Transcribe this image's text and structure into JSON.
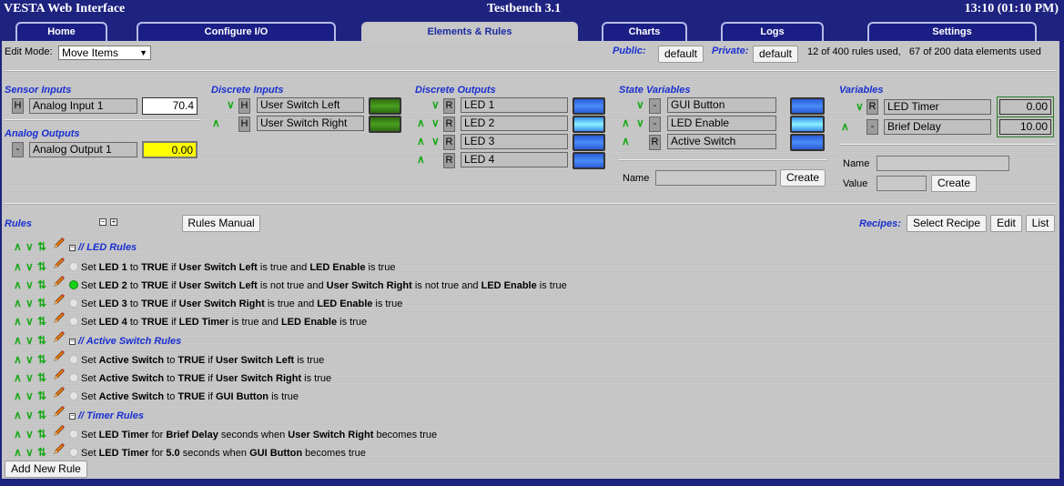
{
  "header": {
    "app_title": "VESTA Web Interface",
    "device": "Testbench 3.1",
    "clock": "13:10 (01:10 PM)"
  },
  "tabs": [
    {
      "label": "Home"
    },
    {
      "label": "Configure I/O"
    },
    {
      "label": "Elements & Rules"
    },
    {
      "label": "Charts"
    },
    {
      "label": "Logs"
    },
    {
      "label": "Settings"
    }
  ],
  "toolbar": {
    "edit_mode_label": "Edit Mode:",
    "edit_mode_value": "Move Items",
    "public_label": "Public:",
    "public_value": "default",
    "private_label": "Private:",
    "private_value": "default",
    "usage": "12 of 400 rules used,   67 of 200 data elements used"
  },
  "sensor_inputs": {
    "title": "Sensor Inputs",
    "items": [
      {
        "tag": "H",
        "name": "Analog Input  1",
        "value": "70.4"
      }
    ]
  },
  "analog_outputs": {
    "title": "Analog Outputs",
    "items": [
      {
        "tag": "-",
        "name": "Analog Output  1",
        "value": "0.00"
      }
    ]
  },
  "discrete_inputs": {
    "title": "Discrete Inputs",
    "items": [
      {
        "tag": "H",
        "name": "User Switch Left"
      },
      {
        "tag": "H",
        "name": "User Switch Right"
      }
    ]
  },
  "discrete_outputs": {
    "title": "Discrete Outputs",
    "items": [
      {
        "tag": "R",
        "name": "LED 1"
      },
      {
        "tag": "R",
        "name": "LED 2"
      },
      {
        "tag": "R",
        "name": "LED 3"
      },
      {
        "tag": "R",
        "name": "LED 4"
      }
    ]
  },
  "state_variables": {
    "title": "State Variables",
    "items": [
      {
        "tag": "-",
        "name": "GUI Button"
      },
      {
        "tag": "-",
        "name": "LED Enable"
      },
      {
        "tag": "R",
        "name": "Active Switch"
      }
    ],
    "name_label": "Name",
    "create_label": "Create"
  },
  "variables": {
    "title": "Variables",
    "items": [
      {
        "tag": "R",
        "name": "LED Timer",
        "value": "0.00"
      },
      {
        "tag": "-",
        "name": "Brief Delay",
        "value": "10.00"
      }
    ],
    "name_label": "Name",
    "value_label": "Value",
    "create_label": "Create"
  },
  "rules": {
    "title": "Rules",
    "manual_button": "Rules Manual",
    "recipes_label": "Recipes:",
    "select_recipe": "Select Recipe",
    "edit": "Edit",
    "list": "List",
    "add_new_rule": "Add New Rule",
    "lines": [
      {
        "comment": "// LED Rules"
      },
      {
        "active": false,
        "parts": [
          [
            "Set ",
            0
          ],
          [
            "LED 1",
            1
          ],
          [
            " to ",
            0
          ],
          [
            "TRUE",
            1
          ],
          [
            " if ",
            0
          ],
          [
            "User Switch Left",
            1
          ],
          [
            " is true and ",
            0
          ],
          [
            "LED Enable",
            1
          ],
          [
            " is true",
            0
          ]
        ]
      },
      {
        "active": true,
        "parts": [
          [
            "Set ",
            0
          ],
          [
            "LED 2",
            1
          ],
          [
            " to ",
            0
          ],
          [
            "TRUE",
            1
          ],
          [
            " if ",
            0
          ],
          [
            "User Switch Left",
            1
          ],
          [
            " is not true and ",
            0
          ],
          [
            "User Switch Right",
            1
          ],
          [
            " is not true and ",
            0
          ],
          [
            "LED Enable",
            1
          ],
          [
            " is true",
            0
          ]
        ]
      },
      {
        "active": false,
        "parts": [
          [
            "Set ",
            0
          ],
          [
            "LED 3",
            1
          ],
          [
            " to ",
            0
          ],
          [
            "TRUE",
            1
          ],
          [
            " if ",
            0
          ],
          [
            "User Switch Right",
            1
          ],
          [
            " is true and ",
            0
          ],
          [
            "LED Enable",
            1
          ],
          [
            " is true",
            0
          ]
        ]
      },
      {
        "active": false,
        "parts": [
          [
            "Set ",
            0
          ],
          [
            "LED 4",
            1
          ],
          [
            " to ",
            0
          ],
          [
            "TRUE",
            1
          ],
          [
            " if ",
            0
          ],
          [
            "LED Timer",
            1
          ],
          [
            " is true and ",
            0
          ],
          [
            "LED Enable",
            1
          ],
          [
            " is true",
            0
          ]
        ]
      },
      {
        "comment": "// Active Switch Rules"
      },
      {
        "active": false,
        "parts": [
          [
            "Set ",
            0
          ],
          [
            "Active Switch",
            1
          ],
          [
            " to ",
            0
          ],
          [
            "TRUE",
            1
          ],
          [
            " if ",
            0
          ],
          [
            "User Switch Left",
            1
          ],
          [
            " is true",
            0
          ]
        ]
      },
      {
        "active": false,
        "parts": [
          [
            "Set ",
            0
          ],
          [
            "Active Switch",
            1
          ],
          [
            " to ",
            0
          ],
          [
            "TRUE",
            1
          ],
          [
            " if ",
            0
          ],
          [
            "User Switch Right",
            1
          ],
          [
            " is true",
            0
          ]
        ]
      },
      {
        "active": false,
        "parts": [
          [
            "Set ",
            0
          ],
          [
            "Active Switch",
            1
          ],
          [
            " to ",
            0
          ],
          [
            "TRUE",
            1
          ],
          [
            " if ",
            0
          ],
          [
            "GUI Button",
            1
          ],
          [
            " is true",
            0
          ]
        ]
      },
      {
        "comment": "// Timer Rules"
      },
      {
        "active": false,
        "parts": [
          [
            "Set ",
            0
          ],
          [
            "LED Timer",
            1
          ],
          [
            " for ",
            0
          ],
          [
            "Brief Delay",
            1
          ],
          [
            " seconds when ",
            0
          ],
          [
            "User Switch Right",
            1
          ],
          [
            " becomes true",
            0
          ]
        ]
      },
      {
        "active": false,
        "parts": [
          [
            "Set ",
            0
          ],
          [
            "LED Timer",
            1
          ],
          [
            " for ",
            0
          ],
          [
            "5.0",
            1
          ],
          [
            " seconds when ",
            0
          ],
          [
            "GUI Button",
            1
          ],
          [
            " becomes true",
            0
          ]
        ]
      }
    ]
  },
  "icons": {
    "up": "up-arrow-icon",
    "down": "down-arrow-icon",
    "move": "move-icon",
    "edit": "pencil-icon",
    "collapse": "collapse-icon"
  },
  "colors": {
    "header_bg": "#1e2380",
    "panel_bg": "#c7c7c7",
    "section_title": "#1a2fd0",
    "arrow_green": "#18a818",
    "led_blue": "#4a8cf8",
    "active_dot": "#18d018"
  }
}
